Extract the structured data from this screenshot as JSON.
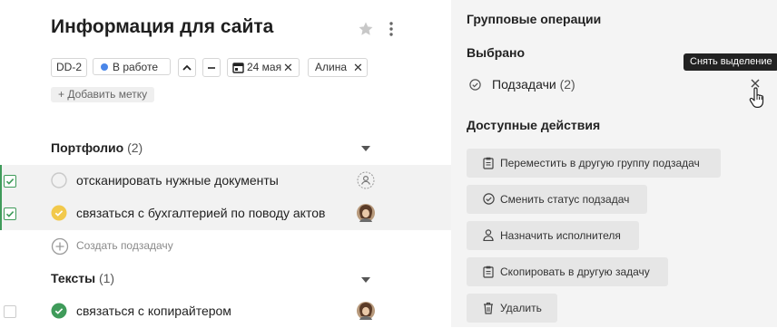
{
  "task": {
    "title": "Информация для сайта",
    "id_chip": "DD-2",
    "status": "В работе",
    "status_color": "#4a86e8",
    "priority_up": "^",
    "priority_dash": "—",
    "due_date": "24 мая",
    "assignee": "Алина",
    "add_label": "+ Добавить метку"
  },
  "groups": [
    {
      "name": "Портфолио",
      "count": "(2)",
      "items": [
        {
          "text": "отсканировать нужные документы",
          "status": "empty",
          "selected": true
        },
        {
          "text": "связаться с бухгалтерией по поводу актов",
          "status": "yellow",
          "selected": true
        }
      ],
      "create_label": "Создать подзадачу"
    },
    {
      "name": "Тексты",
      "count": "(1)",
      "items": [
        {
          "text": "связаться с копирайтером",
          "status": "green",
          "selected": false
        }
      ]
    }
  ],
  "panel": {
    "title": "Групповые операции",
    "selected_heading": "Выбрано",
    "selected_item": "Подзадачи",
    "selected_count": "(2)",
    "tooltip": "Снять выделение",
    "actions_heading": "Доступные действия",
    "actions": [
      {
        "label": "Переместить в другую группу подзадач",
        "icon": "clipboard-icon"
      },
      {
        "label": "Сменить статус подзадач",
        "icon": "check-circle-icon"
      },
      {
        "label": "Назначить исполнителя",
        "icon": "person-icon"
      },
      {
        "label": "Скопировать в другую задачу",
        "icon": "clipboard-icon"
      },
      {
        "label": "Удалить",
        "icon": "trash-icon"
      }
    ]
  },
  "colors": {
    "accent_green": "#3f9b5a",
    "status_yellow": "#f2c94c",
    "status_green": "#3f9b5a"
  }
}
